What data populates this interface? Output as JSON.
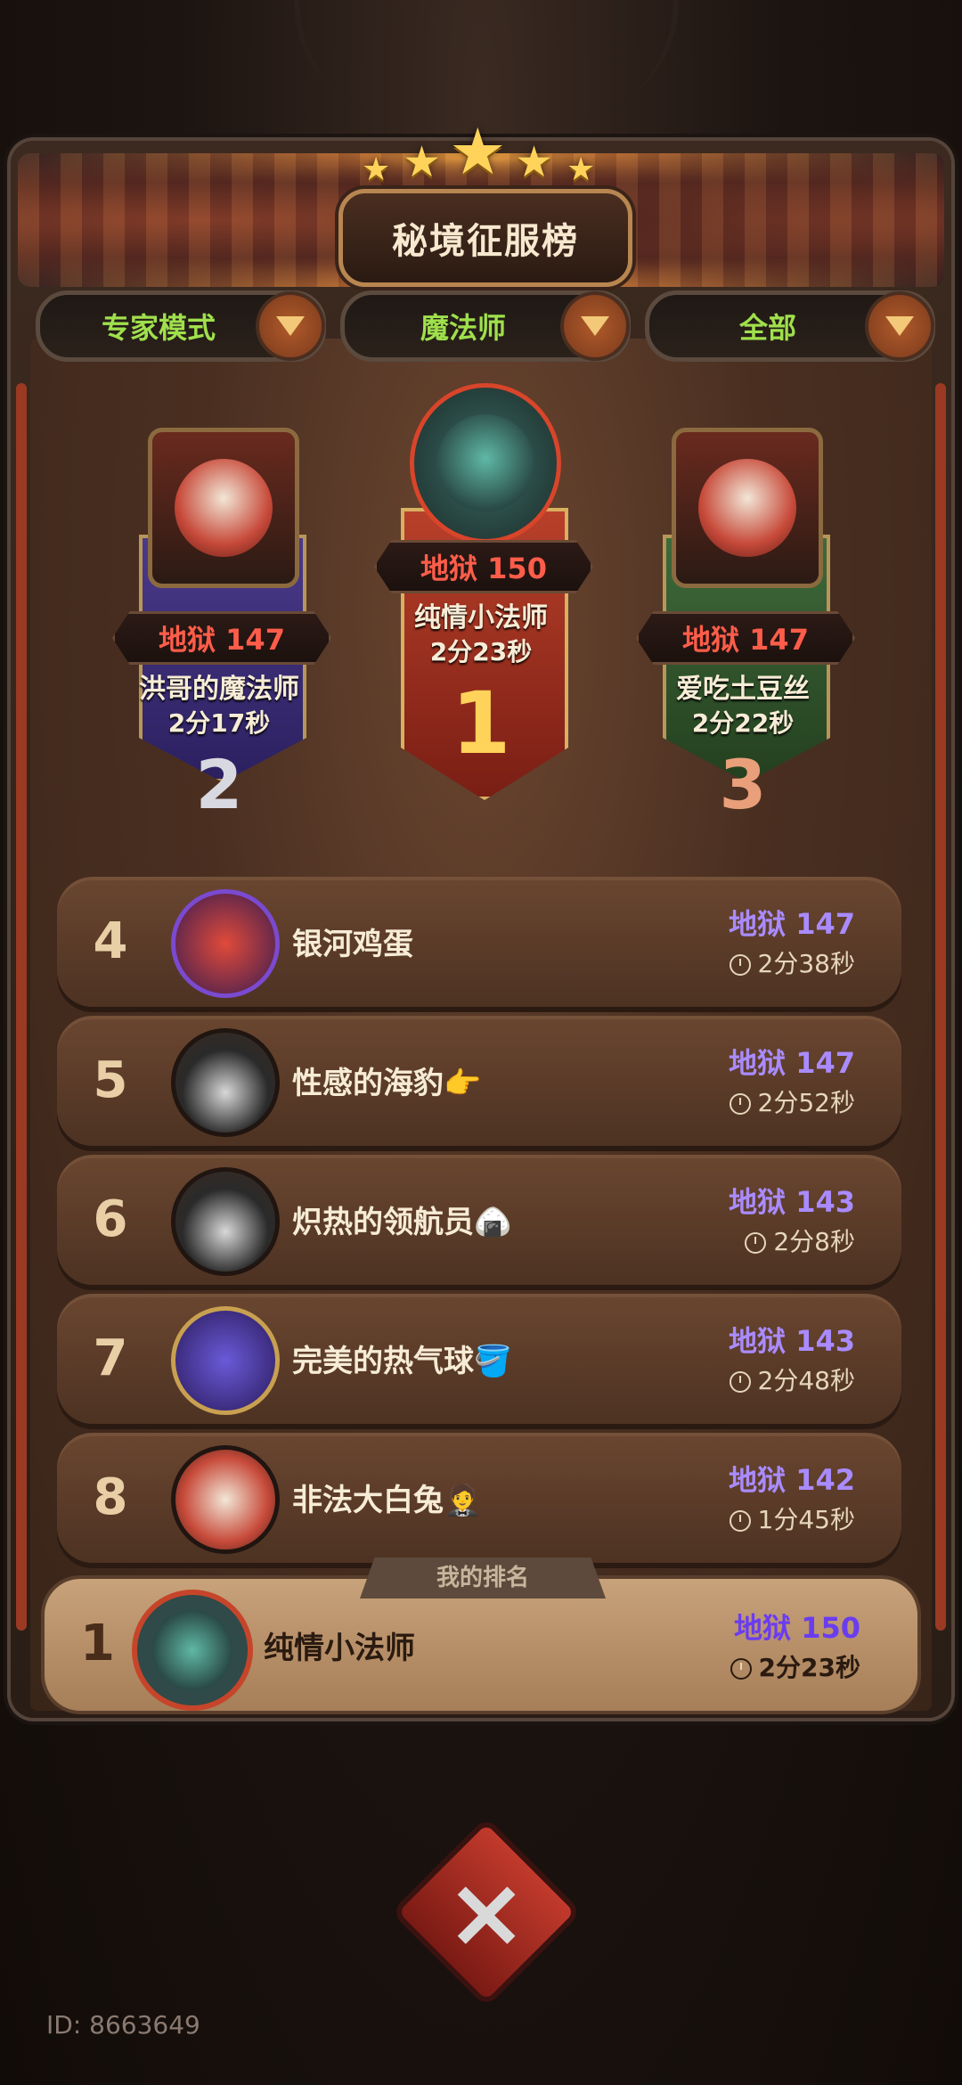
{
  "header": {
    "title": "秘境征服榜"
  },
  "filters": [
    {
      "label": "专家模式"
    },
    {
      "label": "魔法师"
    },
    {
      "label": "全部"
    }
  ],
  "podium": [
    {
      "rank": "1",
      "level": "地狱 150",
      "name": "纯情小法师",
      "time": "2分23秒"
    },
    {
      "rank": "2",
      "level": "地狱 147",
      "name": "洪哥的魔法师",
      "time": "2分17秒"
    },
    {
      "rank": "3",
      "level": "地狱 147",
      "name": "爱吃土豆丝",
      "time": "2分22秒"
    }
  ],
  "list": [
    {
      "rank": "4",
      "name": "银河鸡蛋",
      "level": "地狱 147",
      "time": "2分38秒"
    },
    {
      "rank": "5",
      "name": "性感的海豹👉",
      "level": "地狱 147",
      "time": "2分52秒"
    },
    {
      "rank": "6",
      "name": "炽热的领航员🍙",
      "level": "地狱 143",
      "time": "2分8秒"
    },
    {
      "rank": "7",
      "name": "完美的热气球🪣",
      "level": "地狱 143",
      "time": "2分48秒"
    },
    {
      "rank": "8",
      "name": "非法大白兔🤵",
      "level": "地狱 142",
      "time": "1分45秒"
    }
  ],
  "my_rank": {
    "label": "我的排名",
    "rank": "1",
    "name": "纯情小法师",
    "level": "地狱 150",
    "time": "2分23秒"
  },
  "footer": {
    "id": "ID: 8663649"
  },
  "icons": {
    "close": "close-icon",
    "dropdown": "chevron-down-icon",
    "clock": "clock-icon"
  },
  "colors": {
    "level_purple": "#a98bff",
    "level_red": "#ff5d4a",
    "filter_green": "#9fe04c"
  }
}
